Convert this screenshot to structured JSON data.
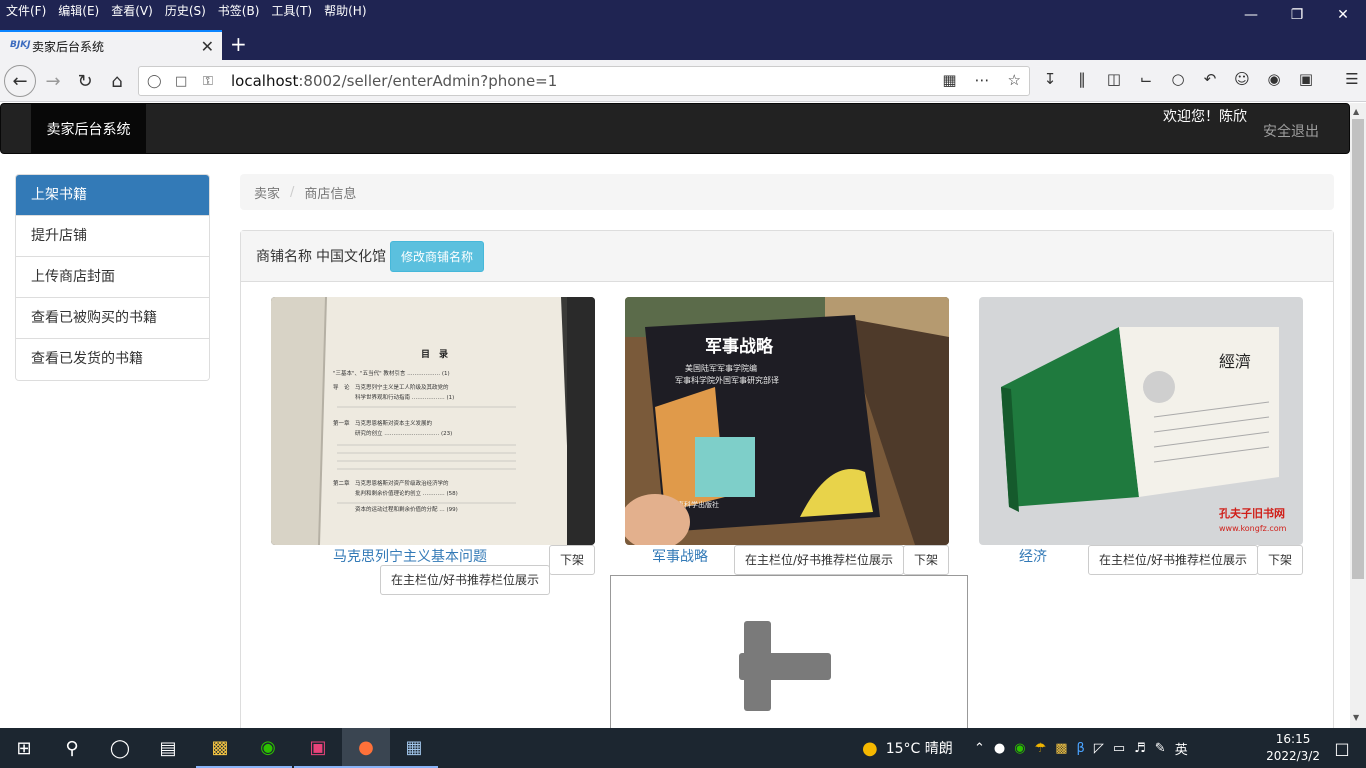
{
  "browser": {
    "menu": [
      "文件(F)",
      "编辑(E)",
      "查看(V)",
      "历史(S)",
      "书签(B)",
      "工具(T)",
      "帮助(H)"
    ],
    "tab_title": "卖家后台系统",
    "tab_favicon": "BJKJ",
    "url_host": "localhost",
    "url_rest": ":8002/seller/enterAdmin?phone=1"
  },
  "site": {
    "brand": "卖家后台系统",
    "welcome": "欢迎您！陈欣",
    "logout": "安全退出"
  },
  "sidebar": {
    "items": [
      {
        "label": "上架书籍",
        "active": true
      },
      {
        "label": "提升店铺"
      },
      {
        "label": "上传商店封面"
      },
      {
        "label": "查看已被购买的书籍"
      },
      {
        "label": "查看已发货的书籍"
      }
    ]
  },
  "breadcrumb": [
    "卖家",
    "商店信息"
  ],
  "shop": {
    "name_label": "商铺名称",
    "name": "中国文化馆",
    "edit_button": "修改商铺名称"
  },
  "books": [
    {
      "title": "马克思列宁主义基本问题",
      "feature_btn": "在主栏位/好书推荐栏位展示",
      "remove_btn": "下架"
    },
    {
      "title": "军事战略",
      "feature_btn": "在主栏位/好书推荐栏位展示",
      "remove_btn": "下架",
      "cover_title": "军事战略",
      "cover_sub1": "美国陆军军事学院编",
      "cover_sub2": "军事科学院外国军事研究部译",
      "cover_pub": "军事科学出版社"
    },
    {
      "title": "经济",
      "feature_btn": "在主栏位/好书推荐栏位展示",
      "remove_btn": "下架",
      "cover_title": "經濟",
      "watermark": "孔夫子旧书网",
      "watermark_url": "www.kongfz.com"
    }
  ],
  "book1_page": {
    "heading": "目　录",
    "lines": [
      "\"三基本\"、\"五当代\" 教材引言 ……………… (1)",
      "导　论　马克思列宁主义是工人阶级及其政党的",
      "　　　　科学世界观和行动指南 ……………… (1)",
      "第一章　马克思恩格斯对资本主义发展的",
      "　　　　研究的创立 ………………………… (23)",
      "第二章　马克思恩格斯对资产阶级政治经济学的",
      "　　　　批判和剩余价值理论的创立 ………… (58)",
      "　　　　资本的运动过程和剩余价值的分配 … (99)"
    ]
  },
  "taskbar": {
    "weather": "15°C  晴朗",
    "ime": "英",
    "time": "16:15",
    "date": "2022/3/2"
  }
}
